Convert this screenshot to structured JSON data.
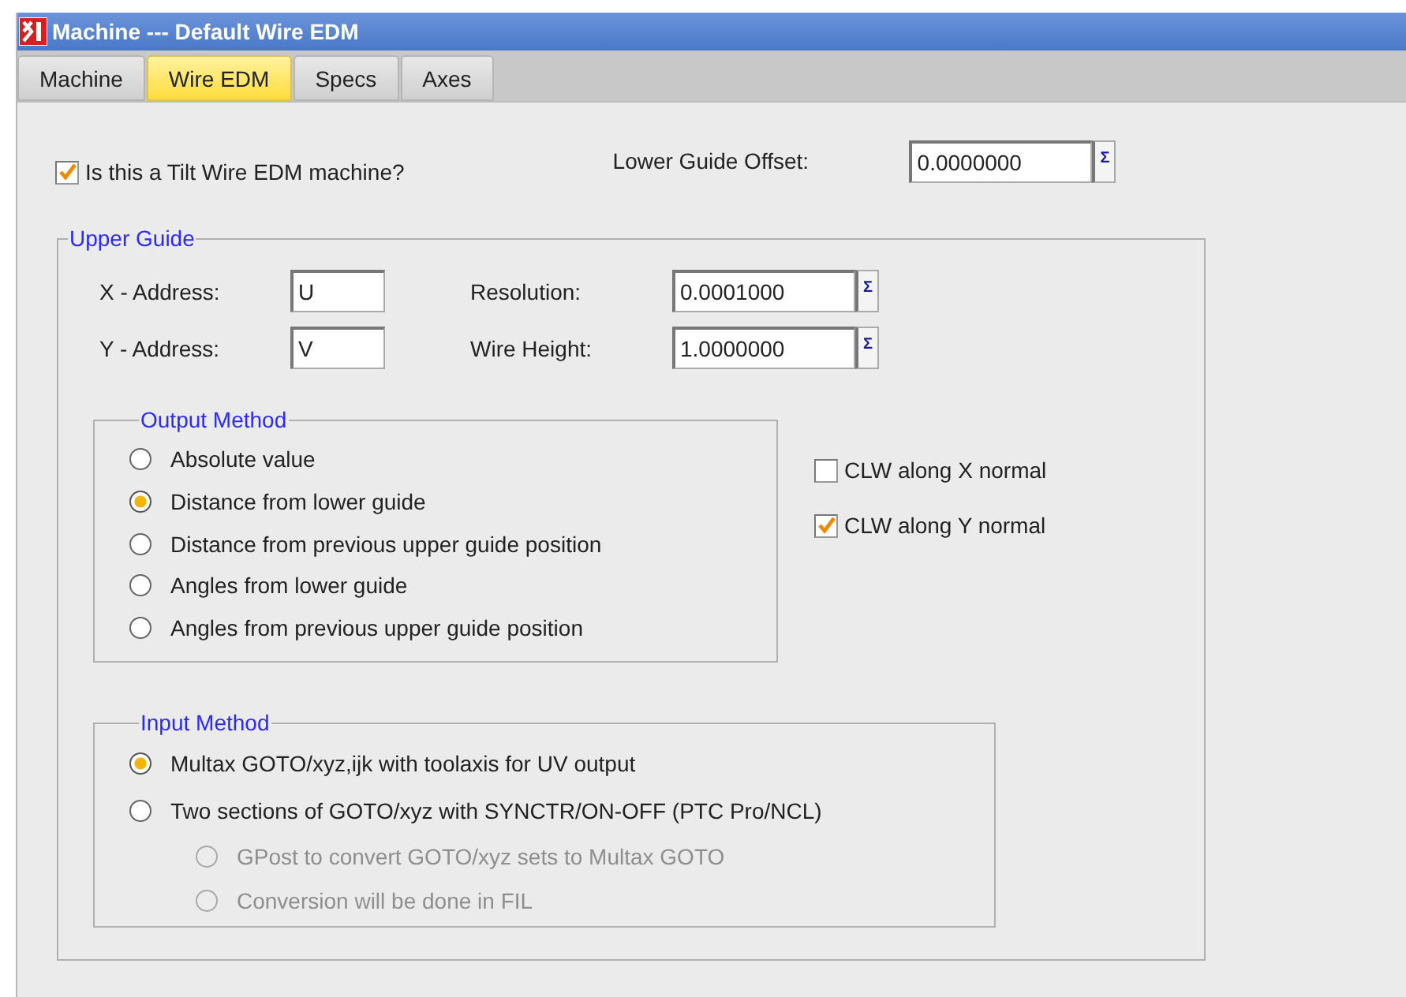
{
  "window": {
    "title": "Machine --- Default Wire EDM"
  },
  "tabs": [
    {
      "label": "Machine",
      "selected": false
    },
    {
      "label": "Wire EDM",
      "selected": true
    },
    {
      "label": "Specs",
      "selected": false
    },
    {
      "label": "Axes",
      "selected": false
    }
  ],
  "tilt_checkbox": {
    "label": "Is this a Tilt Wire EDM machine?",
    "checked": true
  },
  "lower_guide_offset": {
    "label": "Lower Guide Offset:",
    "value": "0.0000000",
    "button": "Σ"
  },
  "upper_guide": {
    "title": "Upper Guide",
    "address_fields": [
      {
        "label": "X - Address:",
        "value": "U"
      },
      {
        "label": "Y - Address:",
        "value": "V"
      }
    ],
    "value_fields": [
      {
        "label": "Resolution:",
        "value": "0.0001000",
        "button": "Σ"
      },
      {
        "label": "Wire Height:",
        "value": "1.0000000",
        "button": "Σ"
      }
    ],
    "output_method": {
      "title": "Output Method",
      "options": [
        {
          "label": "Absolute value",
          "selected": false
        },
        {
          "label": "Distance from lower guide",
          "selected": true
        },
        {
          "label": "Distance from previous upper guide position",
          "selected": false
        },
        {
          "label": "Angles from lower guide",
          "selected": false
        },
        {
          "label": "Angles from previous upper guide position",
          "selected": false
        }
      ]
    },
    "clw_checkboxes": [
      {
        "label": "CLW along X normal",
        "checked": false
      },
      {
        "label": "CLW along Y normal",
        "checked": true
      }
    ],
    "input_method": {
      "title": "Input Method",
      "options": [
        {
          "label": "Multax GOTO/xyz,ijk with toolaxis for UV output",
          "selected": true,
          "disabled": false
        },
        {
          "label": "Two sections of GOTO/xyz with SYNCTR/ON-OFF (PTC Pro/NCL)",
          "selected": false,
          "disabled": false,
          "children": [
            {
              "label": "GPost to convert GOTO/xyz sets to Multax GOTO",
              "selected": false,
              "disabled": true
            },
            {
              "label": "Conversion will be done in FIL",
              "selected": false,
              "disabled": true
            }
          ]
        }
      ]
    }
  }
}
